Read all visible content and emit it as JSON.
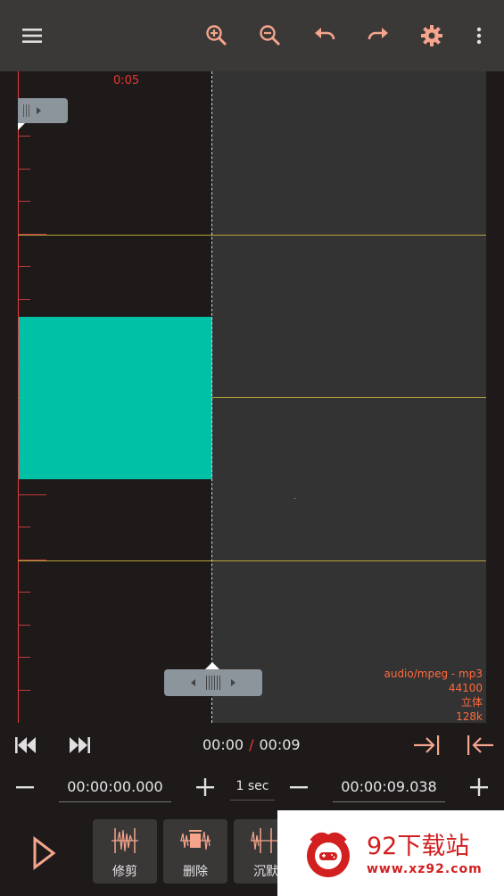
{
  "toolbar": {
    "icons": [
      "menu-icon",
      "zoom-in-icon",
      "zoom-out-icon",
      "undo-icon",
      "redo-icon",
      "settings-icon",
      "more-vert-icon"
    ],
    "accent_color": "#f4a58c"
  },
  "waveform": {
    "time_marker": "0:05",
    "wave_color": "#00c0a6",
    "info": {
      "format": "audio/mpeg - mp3",
      "sample_rate": "44100",
      "channels": "立体",
      "bitrate": "128k"
    }
  },
  "transport": {
    "current_time": "00:00",
    "separator": "/",
    "total_time": "00:09"
  },
  "fields": {
    "start_time": "00:00:00.000",
    "step": "1 sec",
    "end_time": "00:00:09.038"
  },
  "tools": [
    {
      "label": "修剪",
      "icon": "trim-icon"
    },
    {
      "label": "删除",
      "icon": "delete-icon"
    },
    {
      "label": "沉默",
      "icon": "silence-icon"
    }
  ],
  "watermark": {
    "title": "92下载站",
    "url": "www.xz92.com"
  }
}
